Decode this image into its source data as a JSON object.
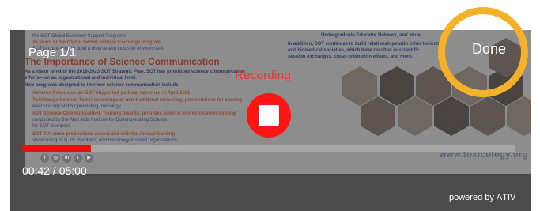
{
  "player": {
    "page_indicator": "Page 1/1",
    "status_label": "Recording",
    "done_label": "Done",
    "current_time": "00:42",
    "total_time": "05:00",
    "time_display": "00:42 / 05:00",
    "progress_fraction": 0.14,
    "powered_by": "powered by ΛTIV"
  },
  "slide": {
    "lines_top": [
      "the SOT Global Economy Support Programs",
      "24 years of the Global Senior Scholar Exchange Program",
      "SOT is continuing to build a diverse and inclusive environment."
    ],
    "heading": "The Importance of Science Communication",
    "intro": [
      "As a major tenet of the 2019-2023 SOT Strategic Plan, SOT has prioritized science communication",
      "efforts—on an organizational and individual level.",
      "New programs designed to improve science communication include:"
    ],
    "bullets": [
      "Adverse Reactions: an SOT-supported podcast launched in April 2021",
      "ToXChange Science Talks: recordings of non-traditional toxicology presentations for sharing",
      "electronically and for promoting toxicology",
      "SOT Science Communications Training Awards: provides science communication training",
      "conducted by the Alan Alda Institute for Communicating Science,",
      "for SOT members",
      "SOT TV: video productions associated with the Annual Meeting",
      "showcasing SOT, its members, and toxicology-focused organizations"
    ],
    "right_text": [
      "Undergraduate Educator Network, and more",
      "In addition, SOT continues to build relationships with other toxicology",
      "and biomedical societies, which have resulted in scientific",
      "session exchanges, cross-promotion efforts, and more."
    ],
    "url": "www.toxicology.org",
    "social_icons": [
      "facebook-icon",
      "instagram-icon",
      "linkedin-icon",
      "twitter-icon",
      "youtube-icon"
    ]
  },
  "colors": {
    "recording_red": "#ff1414",
    "done_ring": "#f6b12a",
    "progress_fill": "#e51010",
    "progress_track": "#a6a6a6"
  }
}
